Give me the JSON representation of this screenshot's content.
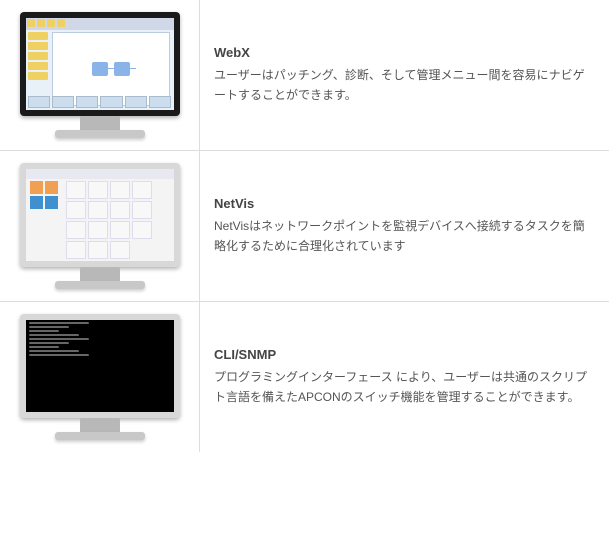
{
  "items": [
    {
      "title": "WebX",
      "desc": "ユーザーはパッチング、診断、そして管理メニュー間を容易にナビゲートすることができます。"
    },
    {
      "title": "NetVis",
      "desc": "NetVisはネットワークポイントを監視デバイスへ接続するタスクを簡略化するために合理化されています"
    },
    {
      "title": "CLI/SNMP",
      "desc": "プログラミングインターフェース により、ユーザーは共通のスクリプト言語を備えたAPCONのスイッチ機能を管理することができます。"
    }
  ]
}
